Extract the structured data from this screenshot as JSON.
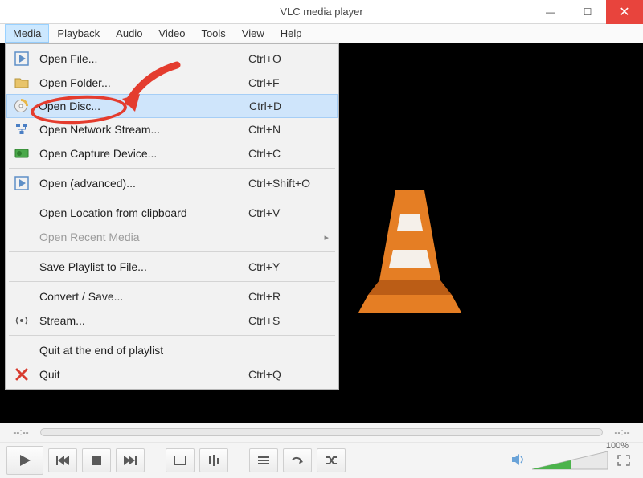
{
  "title": "VLC media player",
  "menubar": [
    "Media",
    "Playback",
    "Audio",
    "Video",
    "Tools",
    "View",
    "Help"
  ],
  "menu_items": [
    {
      "icon": "play-file",
      "label": "Open File...",
      "shortcut": "Ctrl+O"
    },
    {
      "icon": "folder",
      "label": "Open Folder...",
      "shortcut": "Ctrl+F"
    },
    {
      "icon": "disc",
      "label": "Open Disc...",
      "shortcut": "Ctrl+D",
      "highlight": true
    },
    {
      "icon": "network",
      "label": "Open Network Stream...",
      "shortcut": "Ctrl+N"
    },
    {
      "icon": "capture",
      "label": "Open Capture Device...",
      "shortcut": "Ctrl+C"
    },
    {
      "sep": true
    },
    {
      "icon": "play-file",
      "label": "Open (advanced)...",
      "shortcut": "Ctrl+Shift+O"
    },
    {
      "sep": true
    },
    {
      "icon": "",
      "label": "Open Location from clipboard",
      "shortcut": "Ctrl+V"
    },
    {
      "icon": "",
      "label": "Open Recent Media",
      "shortcut": "",
      "disabled": true,
      "submenu": true
    },
    {
      "sep": true
    },
    {
      "icon": "",
      "label": "Save Playlist to File...",
      "shortcut": "Ctrl+Y"
    },
    {
      "sep": true
    },
    {
      "icon": "",
      "label": "Convert / Save...",
      "shortcut": "Ctrl+R"
    },
    {
      "icon": "stream",
      "label": "Stream...",
      "shortcut": "Ctrl+S"
    },
    {
      "sep": true
    },
    {
      "icon": "",
      "label": "Quit at the end of playlist",
      "shortcut": ""
    },
    {
      "icon": "quit",
      "label": "Quit",
      "shortcut": "Ctrl+Q"
    }
  ],
  "time_left": "--:--",
  "time_right": "--:--",
  "volume_label": "100%"
}
